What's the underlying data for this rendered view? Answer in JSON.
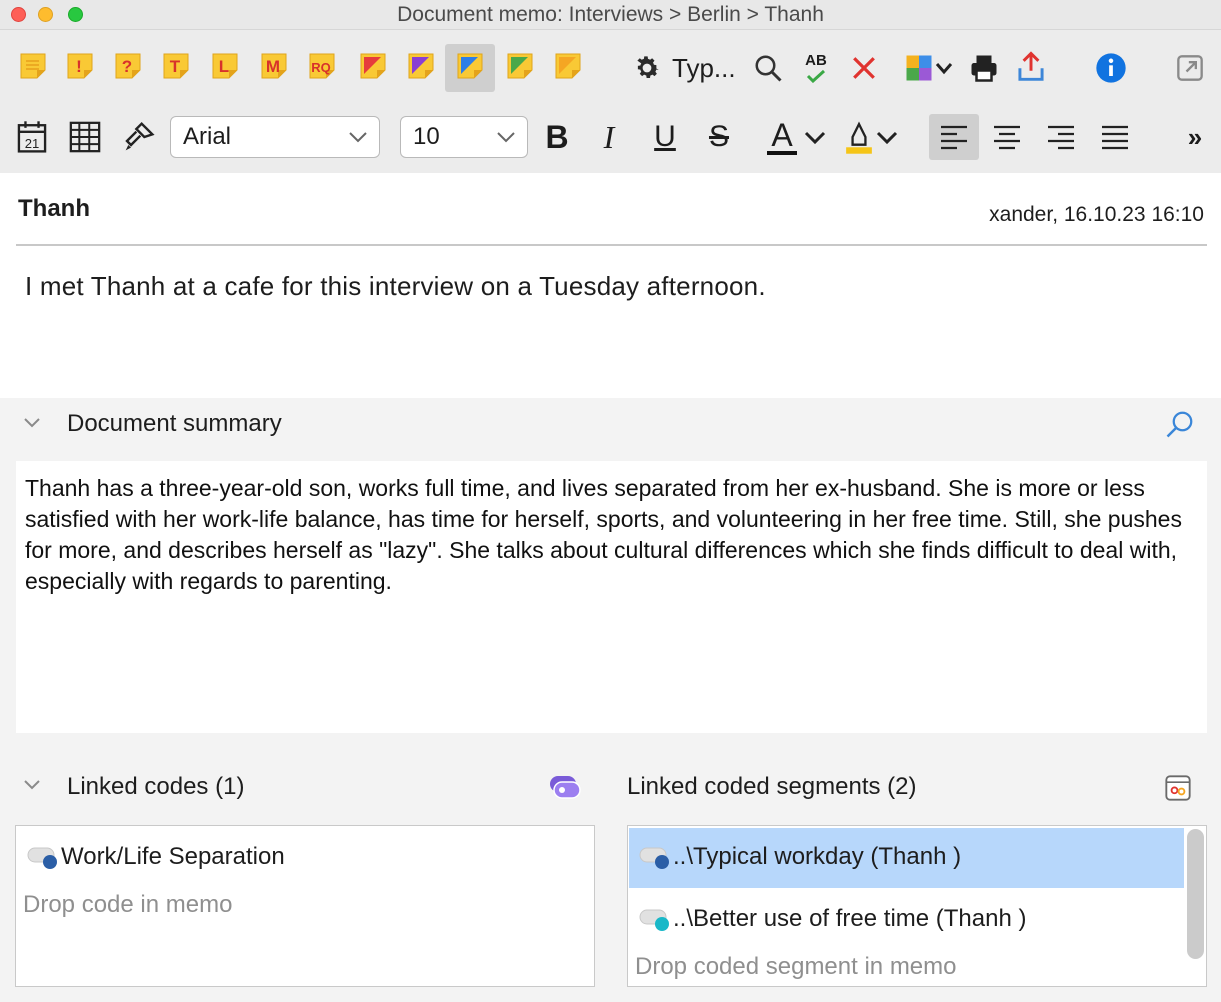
{
  "window": {
    "title": "Document memo: Interviews > Berlin > Thanh"
  },
  "toolbar": {
    "memo_types": [
      {
        "name": "default-memo",
        "letter": "",
        "color": "#f9c935",
        "ink": "#e9a21e"
      },
      {
        "name": "exclamation-memo",
        "letter": "!",
        "color": "#f9c935",
        "ink": "#d8322b"
      },
      {
        "name": "question-memo",
        "letter": "?",
        "color": "#f9c935",
        "ink": "#d8322b"
      },
      {
        "name": "t-memo",
        "letter": "T",
        "color": "#f9c935",
        "ink": "#d8322b"
      },
      {
        "name": "l-memo",
        "letter": "L",
        "color": "#f9c935",
        "ink": "#d8322b"
      },
      {
        "name": "m-memo",
        "letter": "M",
        "color": "#f9c935",
        "ink": "#d8322b"
      },
      {
        "name": "rq-memo",
        "letter": "RQ",
        "color": "#f9c935",
        "ink": "#d8322b"
      },
      {
        "name": "red-memo",
        "letter": "",
        "color": "#f9c935",
        "ink": "#e63c3c"
      },
      {
        "name": "purple-memo",
        "letter": "",
        "color": "#f9c935",
        "ink": "#8a3fd3"
      },
      {
        "name": "blue-memo",
        "letter": "",
        "color": "#f9c935",
        "ink": "#2e7ee6"
      },
      {
        "name": "green-memo",
        "letter": "",
        "color": "#f9c935",
        "ink": "#4aa84a"
      },
      {
        "name": "orange-memo",
        "letter": "",
        "color": "#f9c935",
        "ink": "#f5a623"
      }
    ],
    "type_label": "Typ...",
    "font": "Arial",
    "size": "10",
    "bold": "B",
    "italic": "I",
    "underline": "U",
    "strike": "S",
    "font_color_glyph": "A",
    "more": "»",
    "spell_label": "AB"
  },
  "memo": {
    "title": "Thanh",
    "meta": "xander, 16.10.23 16:10",
    "text": "I met Thanh at a cafe for this interview on a Tuesday afternoon."
  },
  "summary": {
    "title": "Document summary",
    "text": "Thanh has a three-year-old son, works full time, and lives separated from her ex-husband. She is more or less satisfied with her work-life balance, has time for herself, sports, and volunteering in her free time. Still, she pushes for more, and describes herself as \"lazy\". She talks about cultural differences which she finds difficult to deal with, especially with regards to parenting."
  },
  "linked_codes": {
    "title": "Linked codes (1)",
    "items": [
      {
        "label": "Work/Life Separation",
        "dot_color": "#2b5ea6"
      }
    ],
    "hint": "Drop code in memo"
  },
  "linked_segments": {
    "title": "Linked coded segments (2)",
    "items": [
      {
        "label": "..\\Typical workday (Thanh )",
        "dot_color": "#2b5ea6"
      },
      {
        "label": "..\\Better use of free time (Thanh )",
        "dot_color": "#19b8c8"
      }
    ],
    "hint": "Drop coded segment in memo"
  }
}
